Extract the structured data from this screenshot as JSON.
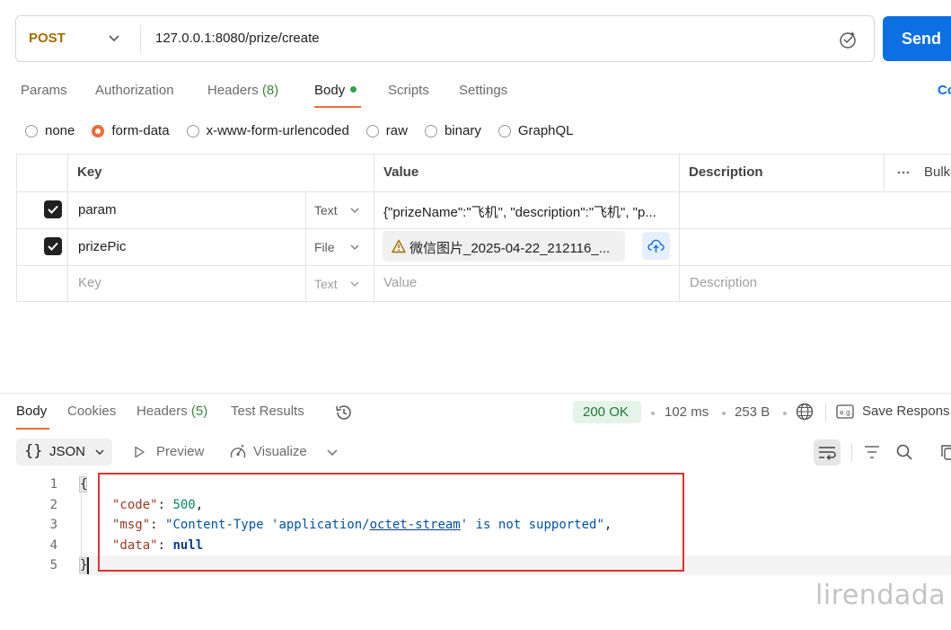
{
  "request": {
    "method": "POST",
    "url": "127.0.0.1:8080/prize/create",
    "send_label": "Send"
  },
  "request_tabs": {
    "params": "Params",
    "authorization": "Authorization",
    "headers": "Headers",
    "headers_count": "(8)",
    "body": "Body",
    "scripts": "Scripts",
    "settings": "Settings",
    "right_link": "Co"
  },
  "body_types": [
    "none",
    "form-data",
    "x-www-form-urlencoded",
    "raw",
    "binary",
    "GraphQL"
  ],
  "body_type_selected": "form-data",
  "form_table": {
    "headers": {
      "key": "Key",
      "value": "Value",
      "description": "Description",
      "bulk": "Bulk"
    },
    "rows": [
      {
        "checked": true,
        "key": "param",
        "type": "Text",
        "value": "{\"prizeName\":\"飞机\", \"description\":\"飞机\", \"p...",
        "description": ""
      },
      {
        "checked": true,
        "key": "prizePic",
        "type": "File",
        "value": "微信图片_2025-04-22_212116_...",
        "description": ""
      }
    ],
    "placeholder": {
      "key": "Key",
      "type": "Text",
      "value": "Value",
      "description": "Description"
    }
  },
  "response_tabs": {
    "body": "Body",
    "cookies": "Cookies",
    "headers": "Headers",
    "headers_count": "(5)",
    "test_results": "Test Results"
  },
  "response_meta": {
    "status": "200 OK",
    "time": "102 ms",
    "size": "253 B",
    "save": "Save Respons"
  },
  "response_toolbar": {
    "format": "JSON",
    "preview": "Preview",
    "visualize": "Visualize"
  },
  "code": {
    "line_numbers": [
      "1",
      "2",
      "3",
      "4",
      "5"
    ],
    "open_brace": "{",
    "close_brace": "}",
    "code_key": "\"code\"",
    "code_val": "500",
    "msg_key": "\"msg\"",
    "msg_val_pre": "\"Content-Type 'application/",
    "msg_val_ul": "octet-stream",
    "msg_val_post": "' is not supported\"",
    "data_key": "\"data\"",
    "data_val": "null"
  },
  "watermark": "lirendada",
  "colors": {
    "accent": "#f26b3a",
    "send": "#0c6fe4",
    "status_ok": "#1f7a37",
    "highlight_box": "#e03131"
  }
}
